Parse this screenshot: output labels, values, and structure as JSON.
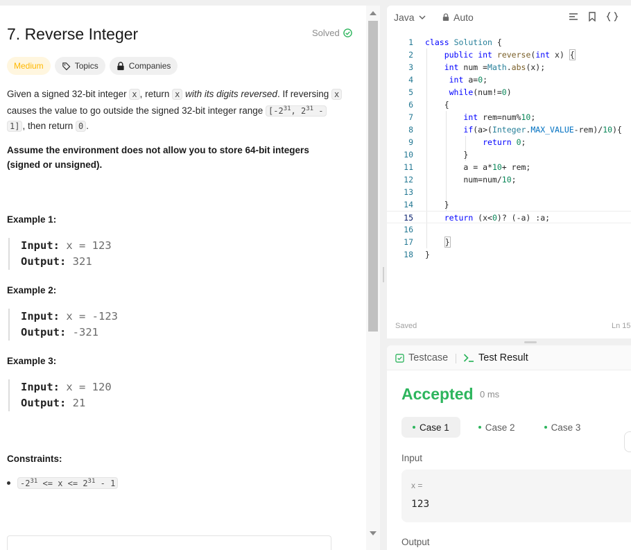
{
  "problem": {
    "title": "7. Reverse Integer",
    "status": "Solved",
    "difficulty": "Medium",
    "tags": [
      "Topics",
      "Companies"
    ],
    "desc": {
      "p1": [
        "Given a signed 32-bit integer ",
        "x",
        ", return ",
        "x",
        " with its digits reversed",
        ". If reversing ",
        "x"
      ],
      "p2a": "causes the value to go outside the signed 32-bit integer range ",
      "range_code_a": "[-2",
      "range_sup_a": "31",
      "range_code_b": ", 2",
      "range_sup_b": "31",
      "range_code_c": " -",
      "p3a": "1]",
      "p3b": ", then return ",
      "p3c": "0",
      "p3d": ".",
      "note_line1": "Assume the environment does not allow you to store 64-bit integers",
      "note_line2": "(signed or unsigned)."
    },
    "examples": [
      {
        "heading": "Example 1:",
        "input_label": "Input:",
        "input": "x = 123",
        "output_label": "Output:",
        "output": "321"
      },
      {
        "heading": "Example 2:",
        "input_label": "Input:",
        "input": "x = -123",
        "output_label": "Output:",
        "output": "-321"
      },
      {
        "heading": "Example 3:",
        "input_label": "Input:",
        "input": "x = 120",
        "output_label": "Output:",
        "output": "21"
      }
    ],
    "constraints_heading": "Constraints:",
    "constraint": {
      "a": "-2",
      "sup1": "31",
      "b": " <= x <= 2",
      "sup2": "31",
      "c": " - 1"
    }
  },
  "editor": {
    "language": "Java",
    "mode": "Auto",
    "status": "Saved",
    "cursor": "Ln 15",
    "line_numbers": [
      "1",
      "2",
      "3",
      "4",
      "5",
      "6",
      "7",
      "8",
      "9",
      "10",
      "11",
      "12",
      "13",
      "14",
      "15",
      "16",
      "17",
      "18"
    ]
  },
  "result": {
    "tabs": [
      "Testcase",
      "Test Result"
    ],
    "verdict": "Accepted",
    "runtime": "0 ms",
    "cases": [
      "Case 1",
      "Case 2",
      "Case 3"
    ],
    "input_label": "Input",
    "input_name": "x =",
    "input_value": "123",
    "output_label": "Output"
  },
  "colors": {
    "accepted": "#2db55d",
    "medium": "#ffb800",
    "solved_check": "#2db55d"
  }
}
